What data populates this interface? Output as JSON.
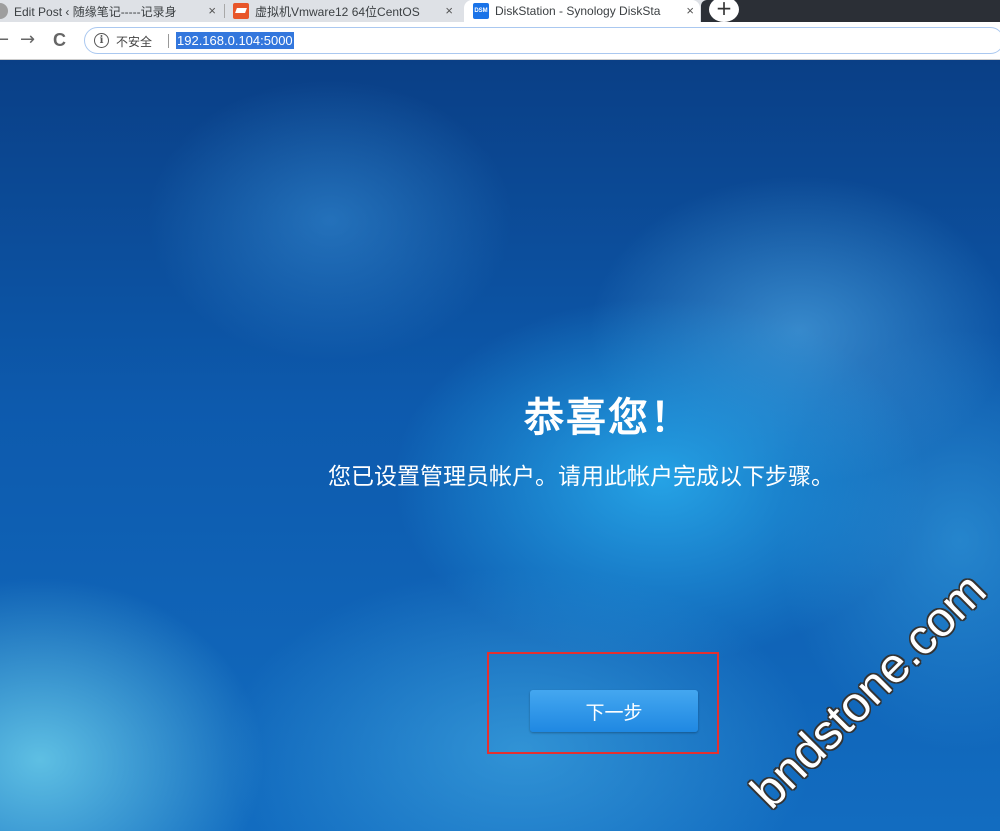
{
  "tabs": [
    {
      "title": "Edit Post ‹ 随缘笔记-----记录身",
      "close": "×",
      "favicon": "wordpress-icon"
    },
    {
      "title": "虚拟机Vmware12 64位CentOS",
      "close": "×",
      "favicon": "segmentfault-icon"
    },
    {
      "title": "DiskStation - Synology DiskSta",
      "close": "×",
      "favicon": "dsm-icon",
      "favicon_text": "DSM",
      "active": true
    }
  ],
  "new_tab": "+",
  "toolbar": {
    "back": "←",
    "forward": "→",
    "reload": "C",
    "security_icon": "i",
    "security_label": "不安全",
    "url": "192.168.0.104:5000"
  },
  "page": {
    "headline": "恭喜您！",
    "subtitle": "您已设置管理员帐户。请用此帐户完成以下步骤。",
    "next_button": "下一步",
    "watermark": "bndstone.com",
    "accent": "#2a93e8",
    "highlight_color": "#e43030"
  }
}
